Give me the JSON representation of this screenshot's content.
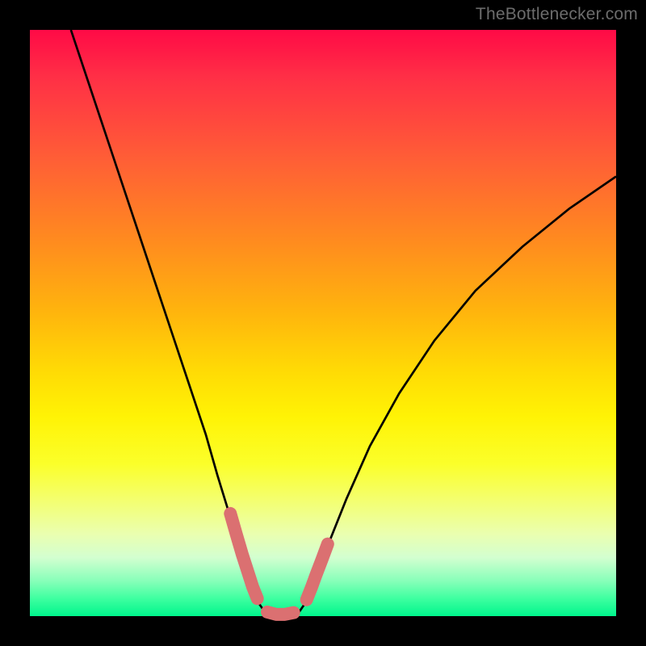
{
  "watermark": "TheBottlenecker.com",
  "chart_data": {
    "type": "line",
    "title": "",
    "xlabel": "",
    "ylabel": "",
    "xlim": [
      0,
      100
    ],
    "ylim": [
      0,
      100
    ],
    "grid": false,
    "series": [
      {
        "name": "bottleneck-curve",
        "stroke": "#000000",
        "stroke_width": 2.7,
        "points": [
          [
            7.0,
            100.0
          ],
          [
            9.0,
            94.0
          ],
          [
            12.0,
            85.0
          ],
          [
            15.0,
            76.0
          ],
          [
            18.0,
            67.0
          ],
          [
            21.0,
            58.0
          ],
          [
            24.0,
            49.0
          ],
          [
            27.0,
            40.0
          ],
          [
            30.0,
            31.0
          ],
          [
            32.0,
            24.0
          ],
          [
            34.0,
            17.5
          ],
          [
            35.5,
            12.0
          ],
          [
            37.0,
            7.0
          ],
          [
            38.5,
            3.0
          ],
          [
            40.0,
            0.8
          ],
          [
            42.0,
            0.0
          ],
          [
            44.0,
            0.0
          ],
          [
            46.0,
            0.8
          ],
          [
            47.5,
            3.0
          ],
          [
            49.0,
            7.0
          ],
          [
            51.0,
            12.5
          ],
          [
            54.0,
            20.0
          ],
          [
            58.0,
            29.0
          ],
          [
            63.0,
            38.0
          ],
          [
            69.0,
            47.0
          ],
          [
            76.0,
            55.5
          ],
          [
            84.0,
            63.0
          ],
          [
            92.0,
            69.5
          ],
          [
            100.0,
            75.0
          ]
        ]
      },
      {
        "name": "marker-cluster-left",
        "stroke": "#db7071",
        "stroke_width": 16,
        "linecap": "round",
        "points": [
          [
            34.2,
            17.5
          ],
          [
            35.2,
            14.0
          ],
          [
            36.2,
            10.6
          ],
          [
            37.2,
            7.5
          ],
          [
            38.0,
            5.0
          ],
          [
            38.8,
            3.0
          ]
        ]
      },
      {
        "name": "marker-cluster-bottom",
        "stroke": "#db7071",
        "stroke_width": 16,
        "linecap": "round",
        "points": [
          [
            40.5,
            0.7
          ],
          [
            42.0,
            0.3
          ],
          [
            43.5,
            0.3
          ],
          [
            45.0,
            0.6
          ]
        ]
      },
      {
        "name": "marker-cluster-right",
        "stroke": "#db7071",
        "stroke_width": 16,
        "linecap": "round",
        "points": [
          [
            47.2,
            2.8
          ],
          [
            48.0,
            4.8
          ],
          [
            48.8,
            7.0
          ],
          [
            49.8,
            9.6
          ],
          [
            50.8,
            12.3
          ]
        ]
      }
    ]
  }
}
